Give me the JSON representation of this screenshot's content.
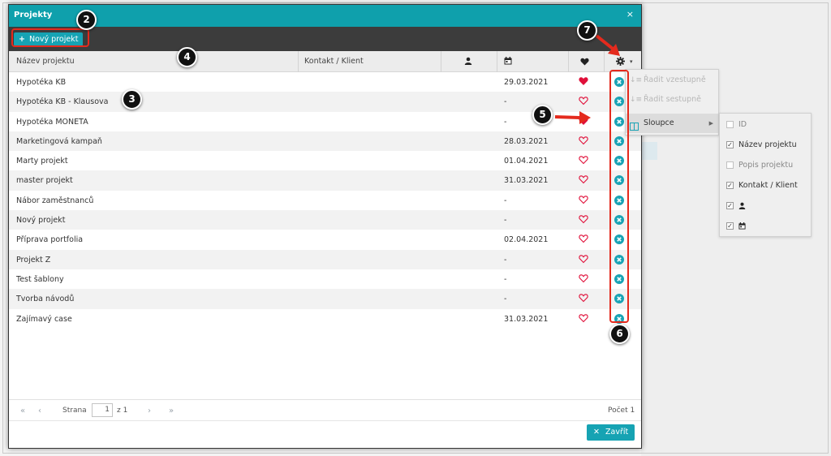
{
  "window": {
    "title": "Projekty",
    "close_symbol": "×"
  },
  "toolbar": {
    "new_project_label": "Nový projekt",
    "new_project_icon": "+"
  },
  "columns": {
    "name": "Název projektu",
    "contact": "Kontakt / Klient",
    "person_icon": "user-icon",
    "date_icon": "calendar-icon",
    "favorite_icon": "heart-icon",
    "settings_icon": "gear-icon",
    "settings_caret": "▾"
  },
  "rows": [
    {
      "name": "Hypotéka KB",
      "date": "29.03.2021",
      "favorite": true
    },
    {
      "name": "Hypotéka KB - Klausova",
      "date": "-",
      "favorite": false
    },
    {
      "name": "Hypotéka MONETA",
      "date": "-",
      "favorite": true
    },
    {
      "name": "Marketingová kampaň",
      "date": "28.03.2021",
      "favorite": false
    },
    {
      "name": "Marty projekt",
      "date": "01.04.2021",
      "favorite": false
    },
    {
      "name": "master projekt",
      "date": "31.03.2021",
      "favorite": false
    },
    {
      "name": "Nábor zaměstnanců",
      "date": "-",
      "favorite": false
    },
    {
      "name": "Nový projekt",
      "date": "-",
      "favorite": false
    },
    {
      "name": "Příprava portfolia",
      "date": "02.04.2021",
      "favorite": false
    },
    {
      "name": "Projekt Z",
      "date": "-",
      "favorite": false
    },
    {
      "name": "Test šablony",
      "date": "-",
      "favorite": false
    },
    {
      "name": "Tvorba návodů",
      "date": "-",
      "favorite": false
    },
    {
      "name": "Zajímavý case",
      "date": "31.03.2021",
      "favorite": false
    }
  ],
  "pagination": {
    "page_label": "Strana",
    "page_value": "1",
    "of_label": "z 1",
    "count_label": "Počet 1"
  },
  "footer": {
    "close_label": "Zavřít",
    "close_icon": "✕"
  },
  "column_menu": {
    "sort_asc": "Řadit vzestupně",
    "sort_desc": "Řadit sestupně",
    "columns": "Sloupce",
    "submenu_arrow": "▶"
  },
  "columns_submenu": [
    {
      "label": "ID",
      "checked": false,
      "icon": ""
    },
    {
      "label": "Název projektu",
      "checked": true,
      "icon": ""
    },
    {
      "label": "Popis projektu",
      "checked": false,
      "icon": ""
    },
    {
      "label": "Kontakt / Klient",
      "checked": true,
      "icon": ""
    },
    {
      "label": "",
      "checked": true,
      "icon": "user-icon"
    },
    {
      "label": "",
      "checked": true,
      "icon": "calendar-icon"
    }
  ],
  "annotations": [
    "2",
    "3",
    "4",
    "5",
    "6",
    "7"
  ],
  "colors": {
    "accent": "#0fa0ac",
    "toolbar": "#3c3c3c",
    "heart_filled": "#e0103a",
    "delete_icon": "#1aa3b5",
    "highlight": "#e42a1d"
  }
}
